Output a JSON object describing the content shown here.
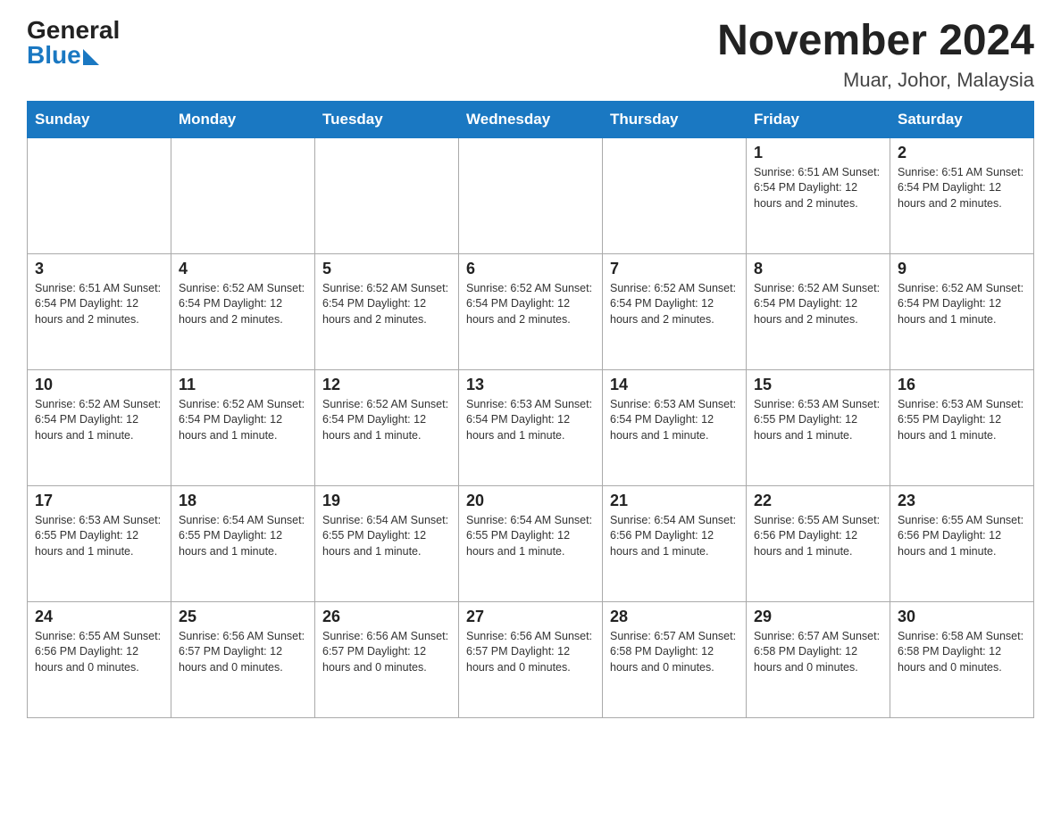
{
  "header": {
    "logo_general": "General",
    "logo_blue": "Blue",
    "title": "November 2024",
    "subtitle": "Muar, Johor, Malaysia"
  },
  "weekdays": [
    "Sunday",
    "Monday",
    "Tuesday",
    "Wednesday",
    "Thursday",
    "Friday",
    "Saturday"
  ],
  "weeks": [
    [
      {
        "day": "",
        "info": ""
      },
      {
        "day": "",
        "info": ""
      },
      {
        "day": "",
        "info": ""
      },
      {
        "day": "",
        "info": ""
      },
      {
        "day": "",
        "info": ""
      },
      {
        "day": "1",
        "info": "Sunrise: 6:51 AM\nSunset: 6:54 PM\nDaylight: 12 hours\nand 2 minutes."
      },
      {
        "day": "2",
        "info": "Sunrise: 6:51 AM\nSunset: 6:54 PM\nDaylight: 12 hours\nand 2 minutes."
      }
    ],
    [
      {
        "day": "3",
        "info": "Sunrise: 6:51 AM\nSunset: 6:54 PM\nDaylight: 12 hours\nand 2 minutes."
      },
      {
        "day": "4",
        "info": "Sunrise: 6:52 AM\nSunset: 6:54 PM\nDaylight: 12 hours\nand 2 minutes."
      },
      {
        "day": "5",
        "info": "Sunrise: 6:52 AM\nSunset: 6:54 PM\nDaylight: 12 hours\nand 2 minutes."
      },
      {
        "day": "6",
        "info": "Sunrise: 6:52 AM\nSunset: 6:54 PM\nDaylight: 12 hours\nand 2 minutes."
      },
      {
        "day": "7",
        "info": "Sunrise: 6:52 AM\nSunset: 6:54 PM\nDaylight: 12 hours\nand 2 minutes."
      },
      {
        "day": "8",
        "info": "Sunrise: 6:52 AM\nSunset: 6:54 PM\nDaylight: 12 hours\nand 2 minutes."
      },
      {
        "day": "9",
        "info": "Sunrise: 6:52 AM\nSunset: 6:54 PM\nDaylight: 12 hours\nand 1 minute."
      }
    ],
    [
      {
        "day": "10",
        "info": "Sunrise: 6:52 AM\nSunset: 6:54 PM\nDaylight: 12 hours\nand 1 minute."
      },
      {
        "day": "11",
        "info": "Sunrise: 6:52 AM\nSunset: 6:54 PM\nDaylight: 12 hours\nand 1 minute."
      },
      {
        "day": "12",
        "info": "Sunrise: 6:52 AM\nSunset: 6:54 PM\nDaylight: 12 hours\nand 1 minute."
      },
      {
        "day": "13",
        "info": "Sunrise: 6:53 AM\nSunset: 6:54 PM\nDaylight: 12 hours\nand 1 minute."
      },
      {
        "day": "14",
        "info": "Sunrise: 6:53 AM\nSunset: 6:54 PM\nDaylight: 12 hours\nand 1 minute."
      },
      {
        "day": "15",
        "info": "Sunrise: 6:53 AM\nSunset: 6:55 PM\nDaylight: 12 hours\nand 1 minute."
      },
      {
        "day": "16",
        "info": "Sunrise: 6:53 AM\nSunset: 6:55 PM\nDaylight: 12 hours\nand 1 minute."
      }
    ],
    [
      {
        "day": "17",
        "info": "Sunrise: 6:53 AM\nSunset: 6:55 PM\nDaylight: 12 hours\nand 1 minute."
      },
      {
        "day": "18",
        "info": "Sunrise: 6:54 AM\nSunset: 6:55 PM\nDaylight: 12 hours\nand 1 minute."
      },
      {
        "day": "19",
        "info": "Sunrise: 6:54 AM\nSunset: 6:55 PM\nDaylight: 12 hours\nand 1 minute."
      },
      {
        "day": "20",
        "info": "Sunrise: 6:54 AM\nSunset: 6:55 PM\nDaylight: 12 hours\nand 1 minute."
      },
      {
        "day": "21",
        "info": "Sunrise: 6:54 AM\nSunset: 6:56 PM\nDaylight: 12 hours\nand 1 minute."
      },
      {
        "day": "22",
        "info": "Sunrise: 6:55 AM\nSunset: 6:56 PM\nDaylight: 12 hours\nand 1 minute."
      },
      {
        "day": "23",
        "info": "Sunrise: 6:55 AM\nSunset: 6:56 PM\nDaylight: 12 hours\nand 1 minute."
      }
    ],
    [
      {
        "day": "24",
        "info": "Sunrise: 6:55 AM\nSunset: 6:56 PM\nDaylight: 12 hours\nand 0 minutes."
      },
      {
        "day": "25",
        "info": "Sunrise: 6:56 AM\nSunset: 6:57 PM\nDaylight: 12 hours\nand 0 minutes."
      },
      {
        "day": "26",
        "info": "Sunrise: 6:56 AM\nSunset: 6:57 PM\nDaylight: 12 hours\nand 0 minutes."
      },
      {
        "day": "27",
        "info": "Sunrise: 6:56 AM\nSunset: 6:57 PM\nDaylight: 12 hours\nand 0 minutes."
      },
      {
        "day": "28",
        "info": "Sunrise: 6:57 AM\nSunset: 6:58 PM\nDaylight: 12 hours\nand 0 minutes."
      },
      {
        "day": "29",
        "info": "Sunrise: 6:57 AM\nSunset: 6:58 PM\nDaylight: 12 hours\nand 0 minutes."
      },
      {
        "day": "30",
        "info": "Sunrise: 6:58 AM\nSunset: 6:58 PM\nDaylight: 12 hours\nand 0 minutes."
      }
    ]
  ]
}
